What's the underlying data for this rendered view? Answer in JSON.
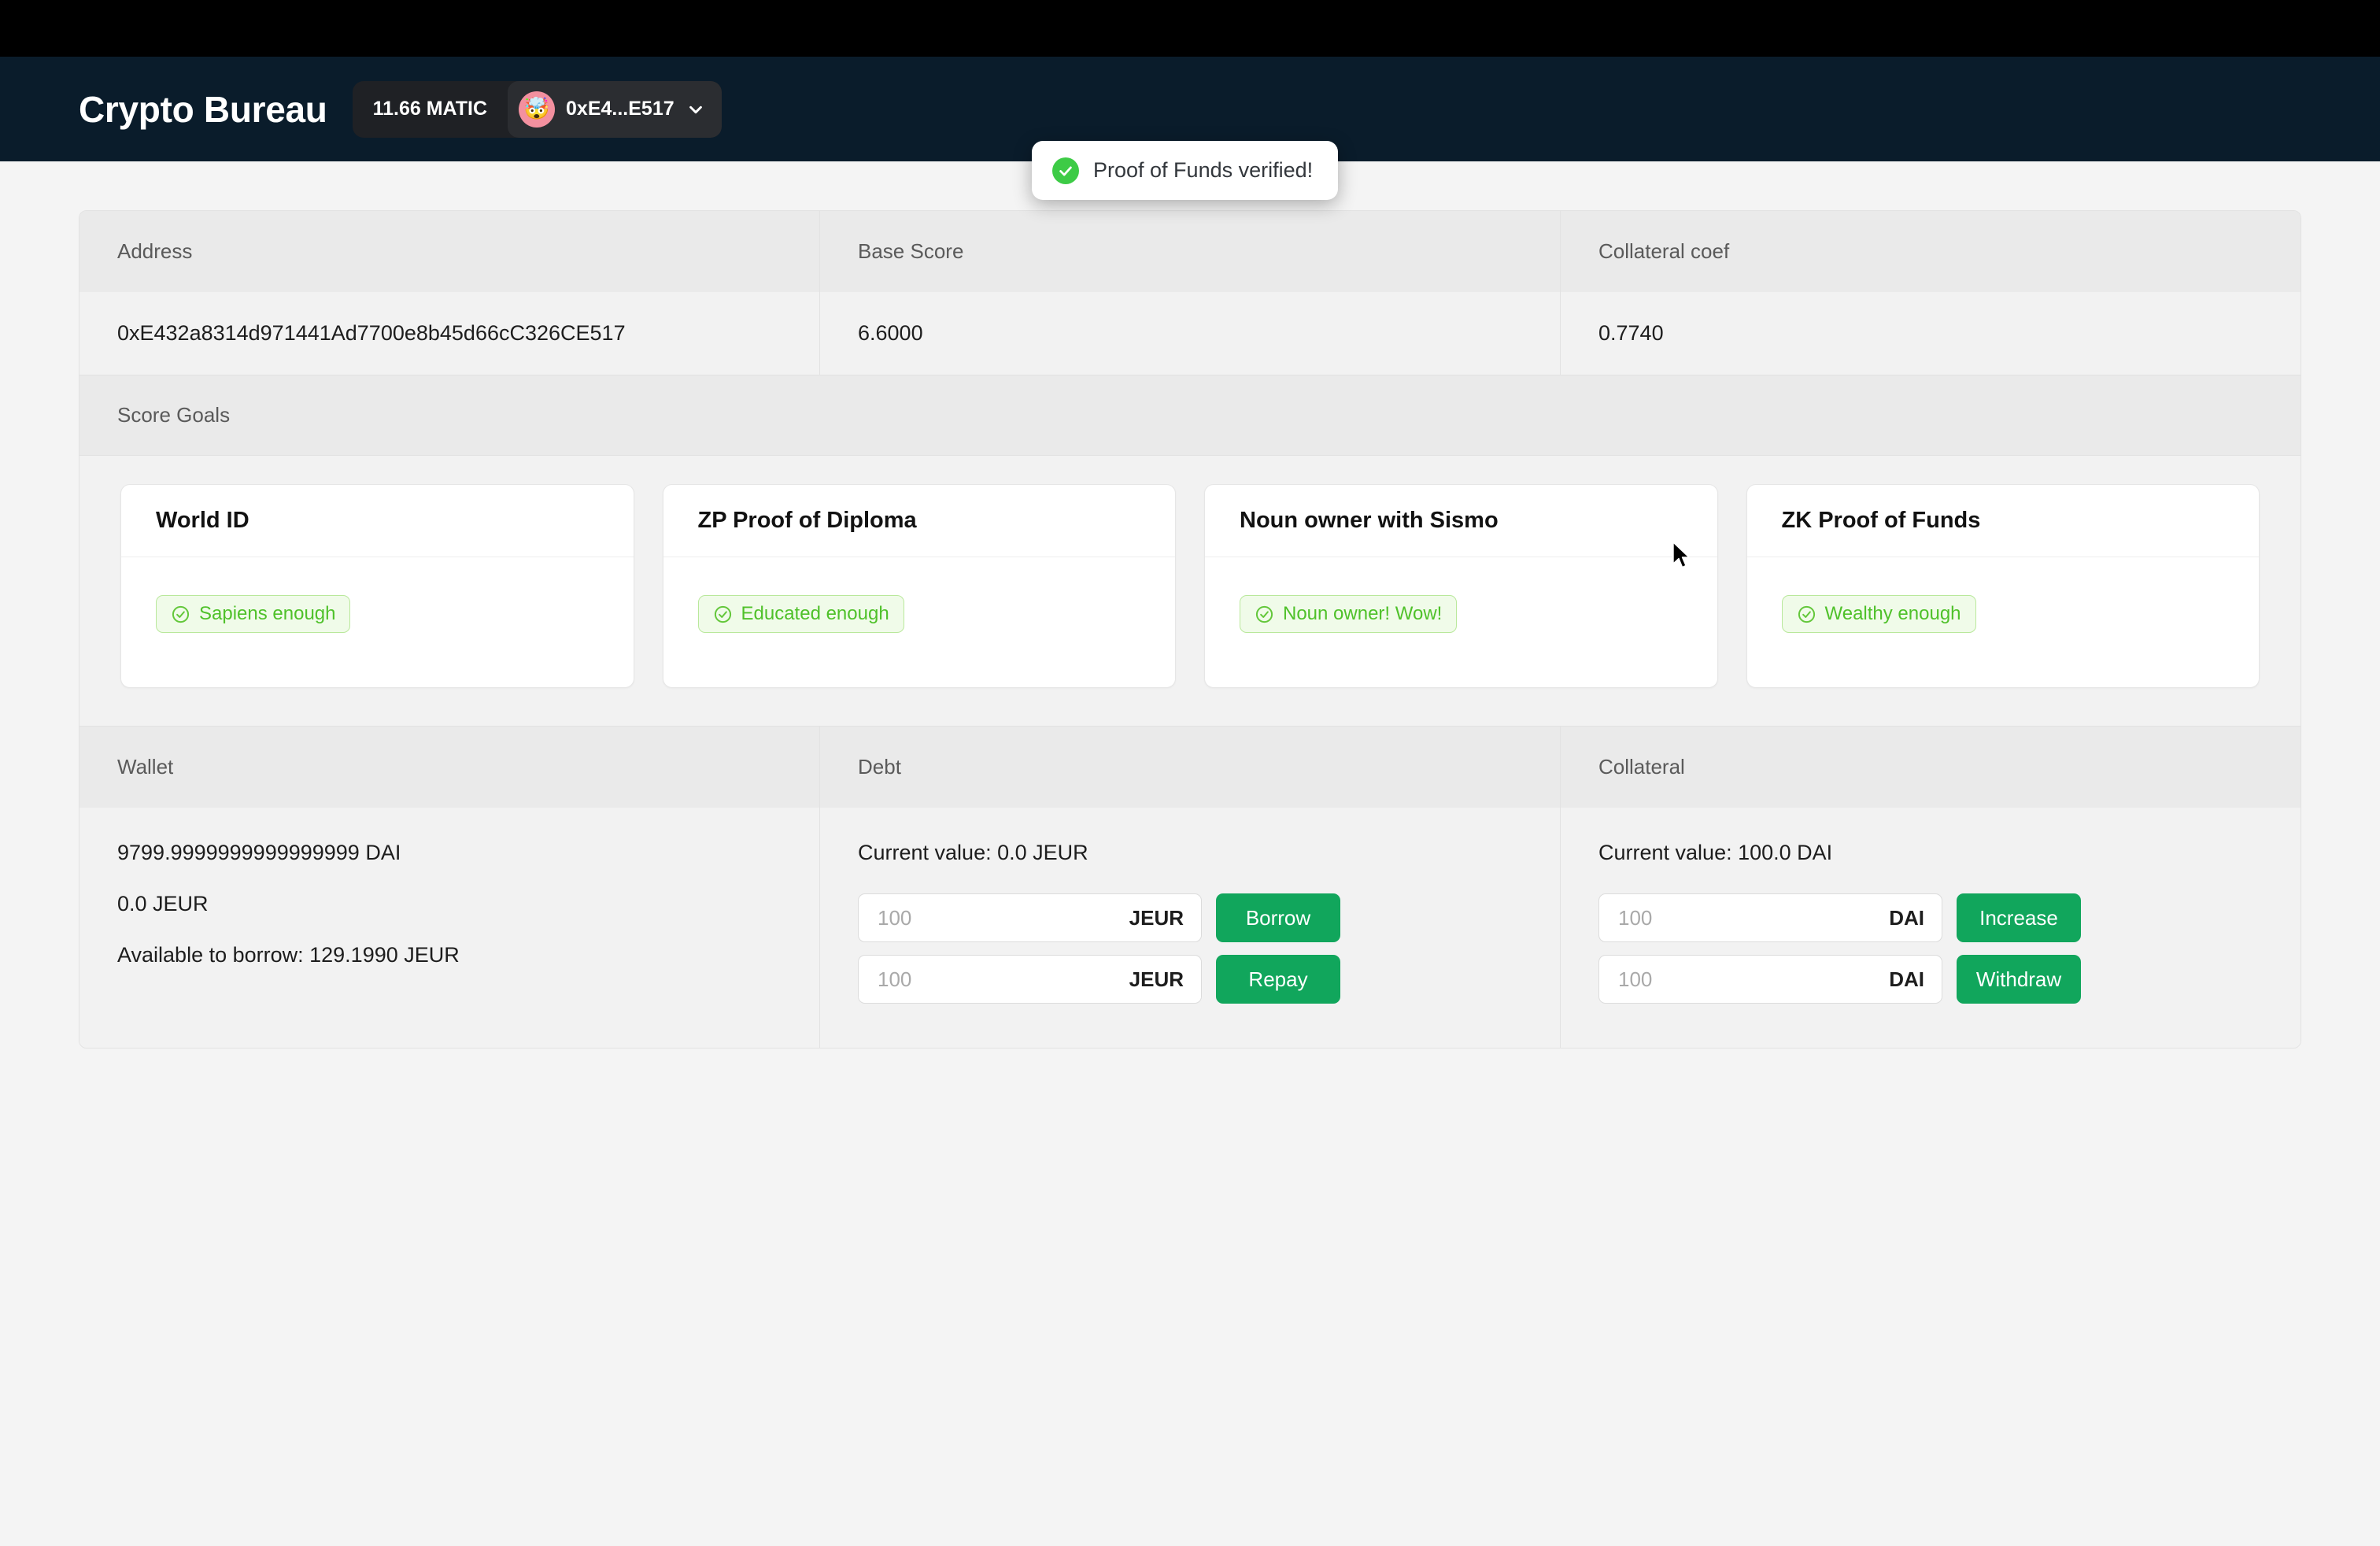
{
  "header": {
    "brand": "Crypto Bureau",
    "matic_balance": "11.66 MATIC",
    "account_address_short": "0xE4...E517",
    "avatar_emoji": "🤯",
    "chevron_icon": "chevron-down-icon"
  },
  "toast": {
    "message": "Proof of Funds verified!",
    "icon": "check-circle-icon",
    "icon_color": "#3dcb46"
  },
  "account_table": {
    "headers": [
      "Address",
      "Base Score",
      "Collateral coef"
    ],
    "values": [
      "0xE432a8314d971441Ad7700e8b45d66cC326CE517",
      "6.6000",
      "0.7740"
    ]
  },
  "score_goals": {
    "section_label": "Score Goals",
    "cards": [
      {
        "title": "World ID",
        "badge": "Sapiens enough",
        "badge_icon": "check-circle-outline-icon"
      },
      {
        "title": "ZP Proof of Diploma",
        "badge": "Educated enough",
        "badge_icon": "check-circle-outline-icon"
      },
      {
        "title": "Noun owner with Sismo",
        "badge": "Noun owner! Wow!",
        "badge_icon": "check-circle-outline-icon"
      },
      {
        "title": "ZK Proof of Funds",
        "badge": "Wealthy enough",
        "badge_icon": "check-circle-outline-icon"
      }
    ]
  },
  "finance": {
    "headers": [
      "Wallet",
      "Debt",
      "Collateral"
    ],
    "wallet": {
      "dai_balance": "9799.9999999999999999 DAI",
      "jeur_balance": "0.0 JEUR",
      "available_to_borrow": "Available to borrow: 129.1990 JEUR"
    },
    "debt": {
      "current_value": "Current value: 0.0 JEUR",
      "rows": [
        {
          "placeholder": "100",
          "value": "",
          "unit": "JEUR",
          "button": "Borrow"
        },
        {
          "placeholder": "100",
          "value": "",
          "unit": "JEUR",
          "button": "Repay"
        }
      ]
    },
    "collateral": {
      "current_value": "Current value: 100.0 DAI",
      "rows": [
        {
          "placeholder": "100",
          "value": "",
          "unit": "DAI",
          "button": "Increase"
        },
        {
          "placeholder": "100",
          "value": "",
          "unit": "DAI",
          "button": "Withdraw"
        }
      ]
    }
  },
  "theme": {
    "header_bg": "#0a1c2b",
    "accent_green": "#11a65c",
    "badge_green": "#4fc12a",
    "panel_bg": "#f2f2f2"
  }
}
